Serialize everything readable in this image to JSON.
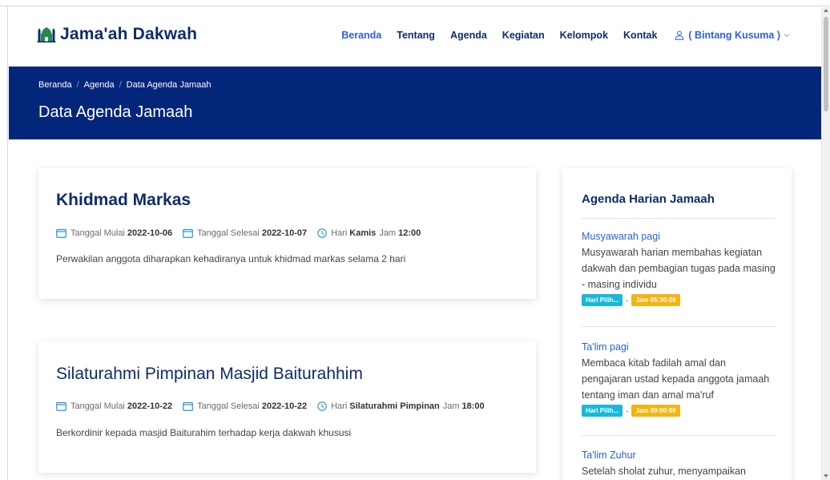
{
  "header": {
    "logo_text": "Jama'ah Dakwah",
    "nav": [
      "Beranda",
      "Tentang",
      "Agenda",
      "Kegiatan",
      "Kelompok",
      "Kontak"
    ],
    "active_nav": "Beranda",
    "user_label": "( Bintang Kusuma )"
  },
  "hero": {
    "breadcrumb": [
      "Beranda",
      "Agenda",
      "Data Agenda Jamaah"
    ],
    "title": "Data Agenda Jamaah"
  },
  "labels": {
    "tanggal_mulai": "Tanggal Mulai",
    "tanggal_selesai": "Tanggal Selesai",
    "hari": "Hari",
    "jam": "Jam"
  },
  "agenda": [
    {
      "title": "Khidmad Markas",
      "start_date": "2022-10-06",
      "end_date": "2022-10-07",
      "day": "Kamis",
      "time": "12:00",
      "description": "Perwakilan anggota diharapkan kehadiranya untuk khidmad markas selama 2 hari"
    },
    {
      "title": "Silaturahmi Pimpinan Masjid Baiturahhim",
      "start_date": "2022-10-22",
      "end_date": "2022-10-22",
      "day": "Silaturahmi Pimpinan",
      "time": "18:00",
      "description": "Berkordinir kepada masjid Baiturahim terhadap kerja dakwah khususi"
    }
  ],
  "sidebar": {
    "title": "Agenda Harian Jamaah",
    "items": [
      {
        "title": "Musyawarah pagi",
        "description": "Musyawarah harian membahas kegiatan dakwah dan pembagian tugas pada masing - masing individu",
        "day_badge": "Hari Pilih...",
        "time_badge": "Jam 05:30:00"
      },
      {
        "title": "Ta'lim pagi",
        "description": "Membaca kitab fadilah amal dan pengajaran ustad kepada anggota jamaah tentang iman dan amal ma'ruf",
        "day_badge": "Hari Pilih...",
        "time_badge": "Jam 09:00:00"
      },
      {
        "title": "Ta'lim Zuhur",
        "description": "Setelah sholat zuhur, menyampaikan"
      }
    ],
    "badge_separator": "-"
  },
  "colors": {
    "navy": "#0f2c6b",
    "hero_bg": "#04267a",
    "link_blue": "#2c5fd9",
    "badge_cyan": "#17b8dc",
    "badge_yellow": "#f2b50f"
  }
}
